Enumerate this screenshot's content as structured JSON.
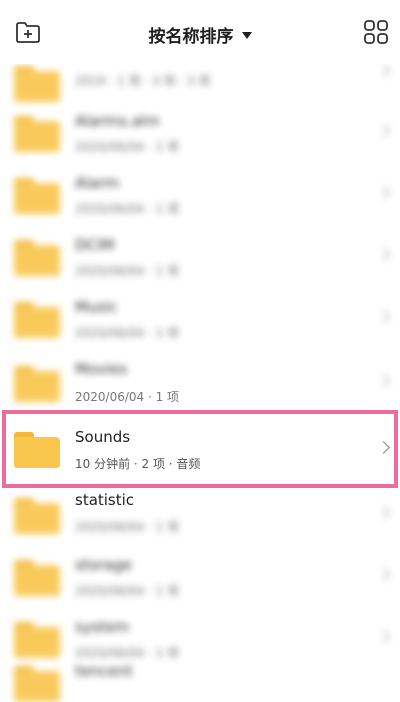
{
  "header": {
    "sort_label": "按名称排序",
    "left_icon": "new-folder-icon",
    "right_icon": "grid-view-icon"
  },
  "folders": [
    {
      "name": "",
      "meta": "2019 · 1 项 · 3 项 · 3 项"
    },
    {
      "name": "Alarms.alm",
      "meta": "2020/06/04 · 1 项"
    },
    {
      "name": "Alarm",
      "meta": "2020/06/04 · 1 项"
    },
    {
      "name": "DCIM",
      "meta": "2020/06/04 · 1 项"
    },
    {
      "name": "Music",
      "meta": "2020/06/04 · 1 项"
    },
    {
      "name": "Movies",
      "meta": "2020/06/04 · 1 项"
    },
    {
      "name": "Sounds",
      "meta": "10 分钟前 · 2 项 · 音频"
    },
    {
      "name": "statistic",
      "meta": "2020/06/04 · 1 项"
    },
    {
      "name": "storage",
      "meta": "2020/06/04 · 1 项"
    },
    {
      "name": "system",
      "meta": "2020/06/04 · 1 项"
    },
    {
      "name": "tencent",
      "meta": "2020/06/04 · 1 项"
    }
  ],
  "colors": {
    "folder": "#f9c64e",
    "highlight": "#ea6d9c"
  }
}
